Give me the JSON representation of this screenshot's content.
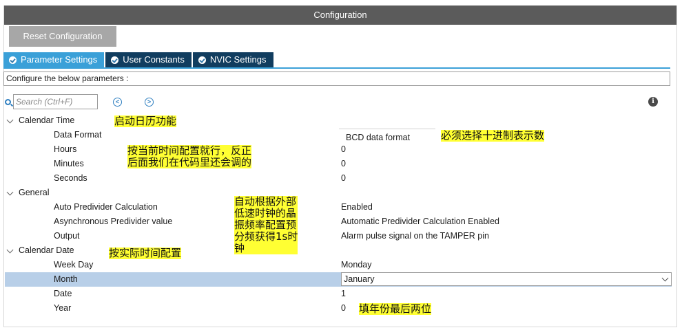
{
  "window": {
    "title": "Configuration"
  },
  "toolbar": {
    "reset_label": "Reset Configuration"
  },
  "tabs": [
    {
      "label": "Parameter Settings",
      "active": true
    },
    {
      "label": "User Constants",
      "active": false
    },
    {
      "label": "NVIC Settings",
      "active": false
    }
  ],
  "config_label": "Configure the below parameters :",
  "search": {
    "placeholder": "Search (Ctrl+F)"
  },
  "groups": {
    "calendar_time": {
      "label": "Calendar Time",
      "params": [
        {
          "label": "Data Format",
          "value": "BCD data format"
        },
        {
          "label": "Hours",
          "value": "0"
        },
        {
          "label": "Minutes",
          "value": "0"
        },
        {
          "label": "Seconds",
          "value": "0"
        }
      ]
    },
    "general": {
      "label": "General",
      "params": [
        {
          "label": "Auto Predivider Calculation",
          "value": "Enabled"
        },
        {
          "label": "Asynchronous Predivider value",
          "value": "Automatic Predivider Calculation Enabled"
        },
        {
          "label": "Output",
          "value": "Alarm pulse signal on the TAMPER pin"
        }
      ]
    },
    "calendar_date": {
      "label": "Calendar Date",
      "params": [
        {
          "label": "Week Day",
          "value": "Monday"
        },
        {
          "label": "Month",
          "value": "January"
        },
        {
          "label": "Date",
          "value": "1"
        },
        {
          "label": "Year",
          "value": "0"
        }
      ]
    }
  },
  "annotations": {
    "enable_calendar": "启动日历功能",
    "time_config": "按当前时间配置就行，反正\n后面我们在代码里还会调的",
    "bcd_note": "必须选择十进制表示数",
    "predivider_note": "自动根据外部\n低速时钟的晶\n振频率配置预\n分频获得1s时\n钟",
    "date_note": "按实际时间配置",
    "year_note": "填年份最后两位"
  },
  "colors": {
    "active_tab": "#3aa0d8",
    "inactive_tab": "#113d5f",
    "titlebar": "#5b5b5b",
    "selected_row": "#b8cfe8",
    "highlight": "#ffff33"
  }
}
